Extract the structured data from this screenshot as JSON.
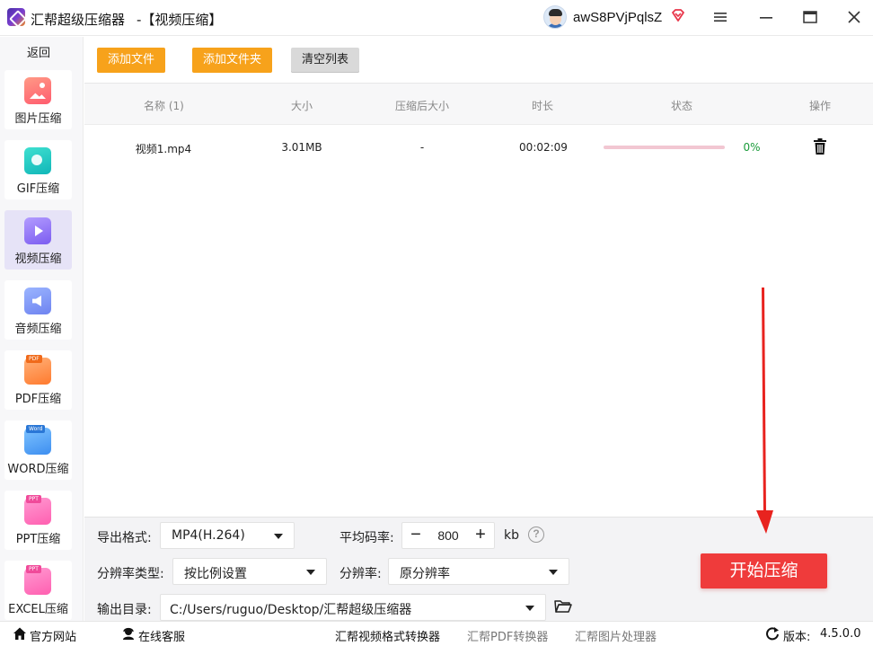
{
  "app": {
    "name": "汇帮超级压缩器",
    "window_title": "-【视频压缩】"
  },
  "user": {
    "name": "awS8PVjPqlsZ",
    "vip_color": "#e8364a"
  },
  "sidebar": {
    "back_label": "返回",
    "items": [
      {
        "label": "图片压缩",
        "icon": "image-icon"
      },
      {
        "label": "GIF压缩",
        "icon": "gif-icon"
      },
      {
        "label": "视频压缩",
        "icon": "video-icon",
        "active": true
      },
      {
        "label": "音频压缩",
        "icon": "audio-icon"
      },
      {
        "label": "PDF压缩",
        "icon": "pdf-icon",
        "tag": "PDF"
      },
      {
        "label": "WORD压缩",
        "icon": "word-icon",
        "tag": "Word"
      },
      {
        "label": "PPT压缩",
        "icon": "ppt-icon",
        "tag": "PPT"
      },
      {
        "label": "EXCEL压缩",
        "icon": "excel-icon",
        "tag": "PPT"
      }
    ]
  },
  "toolbar": {
    "add_file": "添加文件",
    "add_folder": "添加文件夹",
    "clear_list": "清空列表"
  },
  "table": {
    "headers": [
      "名称 (1)",
      "大小",
      "压缩后大小",
      "时长",
      "状态",
      "操作"
    ],
    "rows": [
      {
        "name": "视频1.mp4",
        "size": "3.01MB",
        "compressed_size": "-",
        "duration": "00:02:09",
        "progress_percent": 0,
        "progress_text": "0%"
      }
    ]
  },
  "settings": {
    "format_label": "导出格式:",
    "format_value": "MP4(H.264)",
    "bitrate_label": "平均码率:",
    "bitrate_value": "800",
    "bitrate_unit": "kb",
    "minus": "−",
    "plus": "+",
    "help": "?",
    "res_type_label": "分辨率类型:",
    "res_type_value": "按比例设置",
    "resolution_label": "分辨率:",
    "resolution_value": "原分辨率",
    "output_label": "输出目录:",
    "output_value": "C:/Users/ruguo/Desktop/汇帮超级压缩器",
    "start_button": "开始压缩"
  },
  "footer": {
    "website": "官方网站",
    "support": "在线客服",
    "video_converter": "汇帮视频格式转换器",
    "pdf_converter": "汇帮PDF转换器",
    "image_tool": "汇帮图片处理器",
    "version_label": "版本:",
    "version": "4.5.0.0"
  },
  "colors": {
    "accent_orange": "#f7a21b",
    "start_red": "#ef3b3b",
    "active_sidebar": "#e6e3f7",
    "progress_green": "#1a9b3a"
  }
}
